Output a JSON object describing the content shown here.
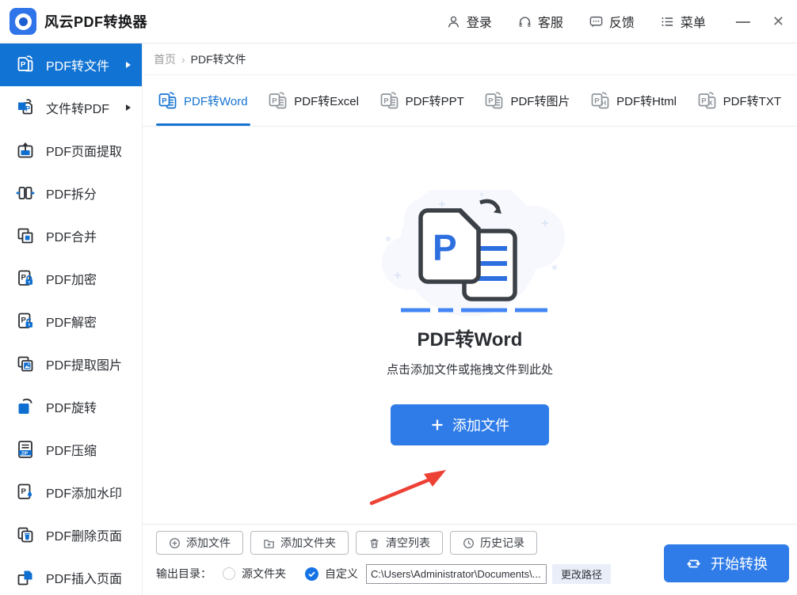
{
  "titlebar": {
    "app_title": "风云PDF转换器",
    "login": "登录",
    "support": "客服",
    "feedback": "反馈",
    "menu": "菜单",
    "minimize": "—",
    "close": "✕"
  },
  "sidebar": {
    "items": [
      {
        "label": "PDF转文件",
        "active": true,
        "has_submenu": true
      },
      {
        "label": "文件转PDF",
        "active": false,
        "has_submenu": true
      },
      {
        "label": "PDF页面提取",
        "active": false,
        "has_submenu": false
      },
      {
        "label": "PDF拆分",
        "active": false,
        "has_submenu": false
      },
      {
        "label": "PDF合并",
        "active": false,
        "has_submenu": false
      },
      {
        "label": "PDF加密",
        "active": false,
        "has_submenu": false
      },
      {
        "label": "PDF解密",
        "active": false,
        "has_submenu": false
      },
      {
        "label": "PDF提取图片",
        "active": false,
        "has_submenu": false
      },
      {
        "label": "PDF旋转",
        "active": false,
        "has_submenu": false
      },
      {
        "label": "PDF压缩",
        "active": false,
        "has_submenu": false
      },
      {
        "label": "PDF添加水印",
        "active": false,
        "has_submenu": false
      },
      {
        "label": "PDF删除页面",
        "active": false,
        "has_submenu": false
      },
      {
        "label": "PDF插入页面",
        "active": false,
        "has_submenu": false
      }
    ]
  },
  "breadcrumb": {
    "home": "首页",
    "separator": "›",
    "current": "PDF转文件"
  },
  "tabs": [
    {
      "label": "PDF转Word",
      "active": true
    },
    {
      "label": "PDF转Excel",
      "active": false
    },
    {
      "label": "PDF转PPT",
      "active": false
    },
    {
      "label": "PDF转图片",
      "active": false
    },
    {
      "label": "PDF转Html",
      "active": false
    },
    {
      "label": "PDF转TXT",
      "active": false
    }
  ],
  "main": {
    "title": "PDF转Word",
    "hint": "点击添加文件或拖拽文件到此处",
    "add_button": "添加文件"
  },
  "footer": {
    "buttons": [
      {
        "label": "添加文件"
      },
      {
        "label": "添加文件夹"
      },
      {
        "label": "清空列表"
      },
      {
        "label": "历史记录"
      }
    ],
    "output_label": "输出目录：",
    "source_folder": "源文件夹",
    "custom": "自定义",
    "custom_selected": true,
    "path_value": "C:\\Users\\Administrator\\Documents\\...",
    "change_path": "更改路径",
    "start_button": "开始转换"
  },
  "colors": {
    "sidebar_active_blue": "#1173d3",
    "tab_active_blue": "#1673d2",
    "button_blue": "#2f7ce8",
    "accent_icon_blue": "#0f6fd1",
    "annotation_arrow_red": "#ee4136"
  }
}
